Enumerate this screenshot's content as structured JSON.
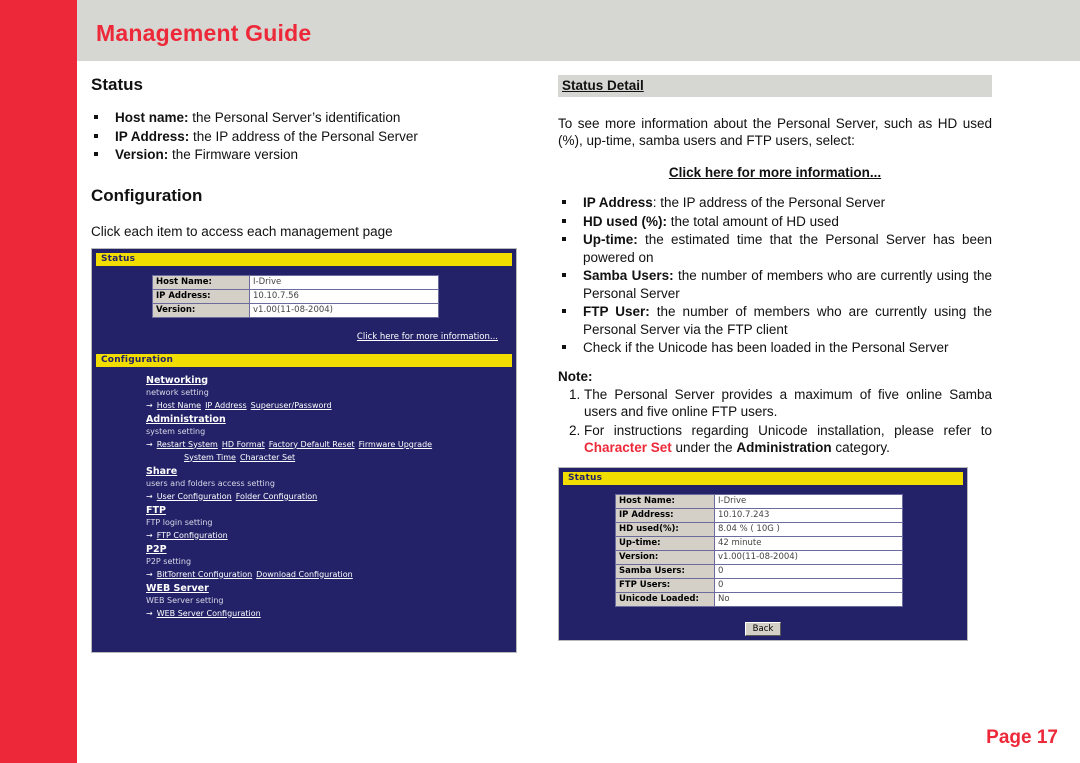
{
  "header": {
    "title": "Management Guide"
  },
  "footer": {
    "page_label": "Page 17"
  },
  "left": {
    "status_heading": "Status",
    "status_bullets": [
      {
        "term": "Host name:",
        "desc": " the Personal Server’s identification"
      },
      {
        "term": "IP Address:",
        "desc": " the IP address of the Personal Server"
      },
      {
        "term": "Version:",
        "desc": " the Firmware version"
      }
    ],
    "configuration_heading": "Configuration",
    "configuration_intro": "Click each item to access each management page",
    "screenshot": {
      "status_bar_label": "Status",
      "table": [
        {
          "key": "Host Name:",
          "value": "I-Drive"
        },
        {
          "key": "IP Address:",
          "value": "10.10.7.56"
        },
        {
          "key": "Version:",
          "value": "v1.00(11-08-2004)"
        }
      ],
      "more_info_link": "Click here for more information...",
      "config_bar_label": "Configuration",
      "groups": [
        {
          "title": "Networking",
          "desc": "network setting",
          "links": [
            "Host Name",
            "IP Address",
            "Superuser/Password"
          ],
          "links2": []
        },
        {
          "title": "Administration",
          "desc": "system setting",
          "links": [
            "Restart System",
            "HD Format",
            "Factory Default Reset",
            "Firmware Upgrade"
          ],
          "links2": [
            "System Time",
            "Character Set"
          ]
        },
        {
          "title": "Share",
          "desc": "users and folders access setting",
          "links": [
            "User Configuration",
            "Folder Configuration"
          ],
          "links2": []
        },
        {
          "title": "FTP",
          "desc": "FTP login setting",
          "links": [
            "FTP Configuration"
          ],
          "links2": []
        },
        {
          "title": "P2P",
          "desc": "P2P setting",
          "links": [
            "BitTorrent Configuration",
            "Download Configuration"
          ],
          "links2": []
        },
        {
          "title": "WEB Server",
          "desc": "WEB Server setting",
          "links": [
            "WEB Server Configuration"
          ],
          "links2": []
        }
      ]
    }
  },
  "right": {
    "section_title": "Status Detail",
    "intro": "To see more information about the Personal Server, such as HD used (%), up-time, samba users and FTP users, select:",
    "center_link": "Click here for more information...",
    "bullets": [
      {
        "term": "IP Address",
        "desc": ": the IP address of the Personal Server"
      },
      {
        "term": "HD used (%):",
        "desc": " the total amount of HD used"
      },
      {
        "term": "Up-time:",
        "desc": " the estimated time that the Personal Server has been powered on"
      },
      {
        "term": "Samba Users:",
        "desc": " the number of members who are currently using the Personal Server"
      },
      {
        "term": "FTP User:",
        "desc": " the number of members who are currently using the Personal Server via the FTP client"
      },
      {
        "term": "",
        "desc": "Check if the Unicode has been loaded in the Personal Server"
      }
    ],
    "note_heading": "Note:",
    "notes": [
      {
        "pre": "The Personal Server provides a maximum of five online Samba users and five online FTP users.",
        "mid": "",
        "post": "",
        "emph": "",
        "bold": ""
      },
      {
        "pre": "For instructions regarding Unicode installation, please refer to ",
        "emph": "Character Set",
        "mid": " under the ",
        "bold": "Administration",
        "post": " category."
      }
    ],
    "screenshot": {
      "status_bar_label": "Status",
      "table": [
        {
          "key": "Host Name:",
          "value": "I-Drive"
        },
        {
          "key": "IP Address:",
          "value": "10.10.7.243"
        },
        {
          "key": "HD used(%):",
          "value": "8.04 % ( 10G )"
        },
        {
          "key": "Up-time:",
          "value": "42 minute"
        },
        {
          "key": "Version:",
          "value": "v1.00(11-08-2004)"
        },
        {
          "key": "Samba Users:",
          "value": "0"
        },
        {
          "key": "FTP Users:",
          "value": "0"
        },
        {
          "key": "Unicode Loaded:",
          "value": "No"
        }
      ],
      "back_button": "Back"
    }
  },
  "colors": {
    "brand_red": "#ED2939",
    "header_gray": "#d6d6d2",
    "panel_navy": "#232268",
    "panel_yellow": "#f2dd00"
  }
}
